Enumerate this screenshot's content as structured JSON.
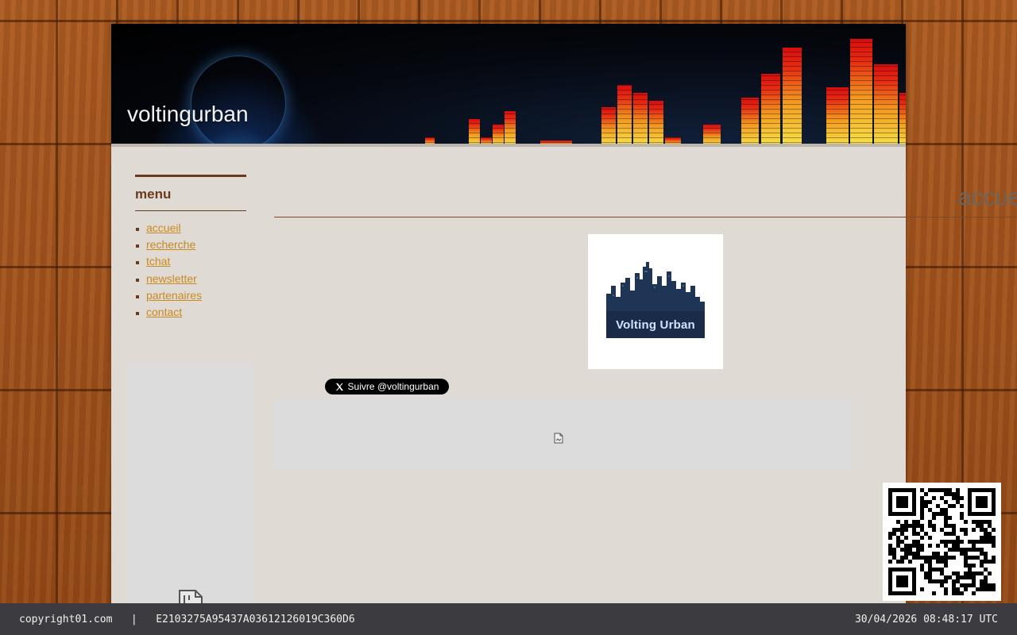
{
  "site": {
    "title": "voltingurban"
  },
  "menu": {
    "heading": "menu",
    "items": [
      {
        "label": "accueil"
      },
      {
        "label": "recherche"
      },
      {
        "label": "tchat"
      },
      {
        "label": "newsletter"
      },
      {
        "label": "partenaires"
      },
      {
        "label": "contact"
      }
    ]
  },
  "main": {
    "page_title_overflow": "accue",
    "logo_text": "Volting Urban",
    "follow_button": "Suivre @voltingurban",
    "follow_icon": "x-logo-icon"
  },
  "footer": {
    "copyright": "copyright01.com",
    "separator": "|",
    "hash": "E2103275A95437A03612126019C360D6",
    "timestamp": "30/04/2026 08:48:17 UTC"
  },
  "colors": {
    "accent_brown": "#6b3a1c",
    "link": "#c98a1f",
    "page_bg": "#e0dad4",
    "footer_bg": "#3c3c40"
  }
}
